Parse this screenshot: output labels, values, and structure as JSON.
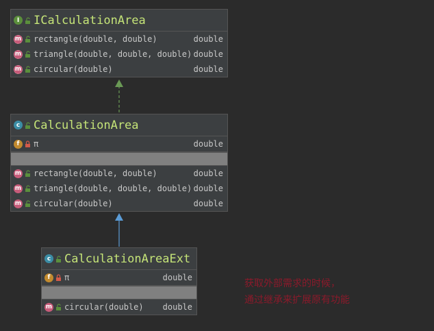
{
  "interface_box": {
    "title": "ICalculationArea",
    "methods": [
      {
        "name": "rectangle(double, double)",
        "type": "double"
      },
      {
        "name": "triangle(double, double, double)",
        "type": "double"
      },
      {
        "name": "circular(double)",
        "type": "double"
      }
    ]
  },
  "class_box": {
    "title": "CalculationArea",
    "fields": [
      {
        "name": "π",
        "type": "double"
      }
    ],
    "methods": [
      {
        "name": "rectangle(double, double)",
        "type": "double"
      },
      {
        "name": "triangle(double, double, double)",
        "type": "double"
      },
      {
        "name": "circular(double)",
        "type": "double"
      }
    ]
  },
  "ext_box": {
    "title": "CalculationAreaExt",
    "fields": [
      {
        "name": "π",
        "type": "double"
      }
    ],
    "methods": [
      {
        "name": "circular(double)",
        "type": "double"
      }
    ]
  },
  "note": {
    "line1": "获取外部需求的时候，",
    "line2": "通过继承来扩展原有功能"
  },
  "colors": {
    "background": "#2b2b2b",
    "title_green": "#c5e478",
    "implements_arrow": "#6a9955",
    "extends_arrow": "#5b9bd5",
    "note_red": "#8b1a2b"
  }
}
